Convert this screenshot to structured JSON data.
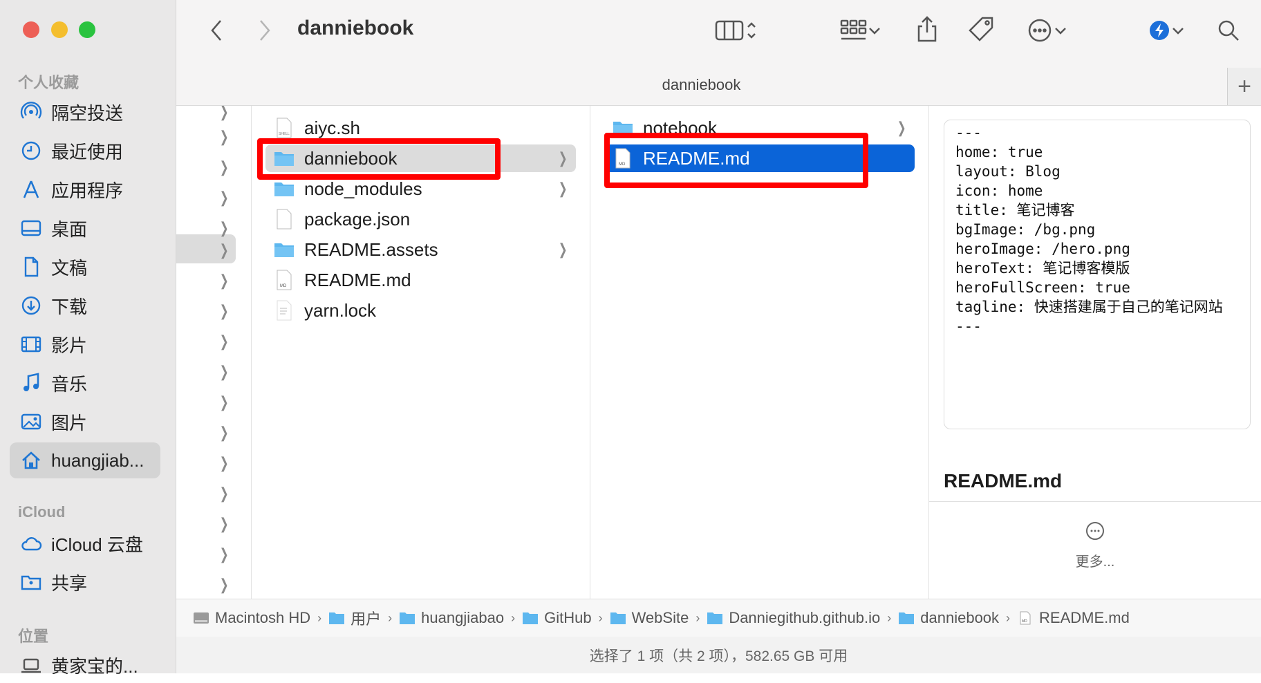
{
  "window": {
    "title": "danniebook",
    "tab_title": "danniebook"
  },
  "colors": {
    "accent": "#0b64d8",
    "folder": "#5db7ef",
    "annotation_red": "#ff0000"
  },
  "sidebar": {
    "favorites_title": "个人收藏",
    "favorites": [
      {
        "label": "隔空投送",
        "icon": "airdrop-icon"
      },
      {
        "label": "最近使用",
        "icon": "clock-icon"
      },
      {
        "label": "应用程序",
        "icon": "applications-icon"
      },
      {
        "label": "桌面",
        "icon": "desktop-icon"
      },
      {
        "label": "文稿",
        "icon": "document-icon"
      },
      {
        "label": "下载",
        "icon": "download-icon"
      },
      {
        "label": "影片",
        "icon": "film-icon"
      },
      {
        "label": "音乐",
        "icon": "music-icon"
      },
      {
        "label": "图片",
        "icon": "photo-icon"
      },
      {
        "label": "huangjiab...",
        "icon": "home-icon"
      }
    ],
    "icloud_title": "iCloud",
    "icloud": [
      {
        "label": "iCloud 云盘",
        "icon": "cloud-icon"
      },
      {
        "label": "共享",
        "icon": "shared-folder-icon"
      }
    ],
    "locations_title": "位置",
    "locations": [
      {
        "label": "黄家宝的...",
        "icon": "laptop-icon"
      }
    ]
  },
  "column2": [
    {
      "name": "aiyc.sh",
      "type": "shell"
    },
    {
      "name": "danniebook",
      "type": "folder"
    },
    {
      "name": "node_modules",
      "type": "folder"
    },
    {
      "name": "package.json",
      "type": "file"
    },
    {
      "name": "README.assets",
      "type": "folder"
    },
    {
      "name": "README.md",
      "type": "md"
    },
    {
      "name": "yarn.lock",
      "type": "text"
    }
  ],
  "column3": [
    {
      "name": "notebook",
      "type": "folder"
    },
    {
      "name": "README.md",
      "type": "md"
    }
  ],
  "preview": {
    "content": "---\nhome: true\nlayout: Blog\nicon: home\ntitle: 笔记博客\nbgImage: /bg.png\nheroImage: /hero.png\nheroText: 笔记博客模版\nheroFullScreen: true\ntagline: 快速搭建属于自己的笔记网站\n---",
    "filename": "README.md",
    "more_label": "更多..."
  },
  "pathbar": [
    {
      "label": "Macintosh HD",
      "icon": "disk-icon"
    },
    {
      "label": "用户",
      "icon": "folder-icon"
    },
    {
      "label": "huangjiabao",
      "icon": "folder-icon"
    },
    {
      "label": "GitHub",
      "icon": "folder-icon"
    },
    {
      "label": "WebSite",
      "icon": "folder-icon"
    },
    {
      "label": "Danniegithub.github.io",
      "icon": "folder-icon"
    },
    {
      "label": "danniebook",
      "icon": "folder-icon"
    },
    {
      "label": "README.md",
      "icon": "md-file-icon"
    }
  ],
  "status": "选择了 1 项（共 2 项），582.65 GB 可用"
}
